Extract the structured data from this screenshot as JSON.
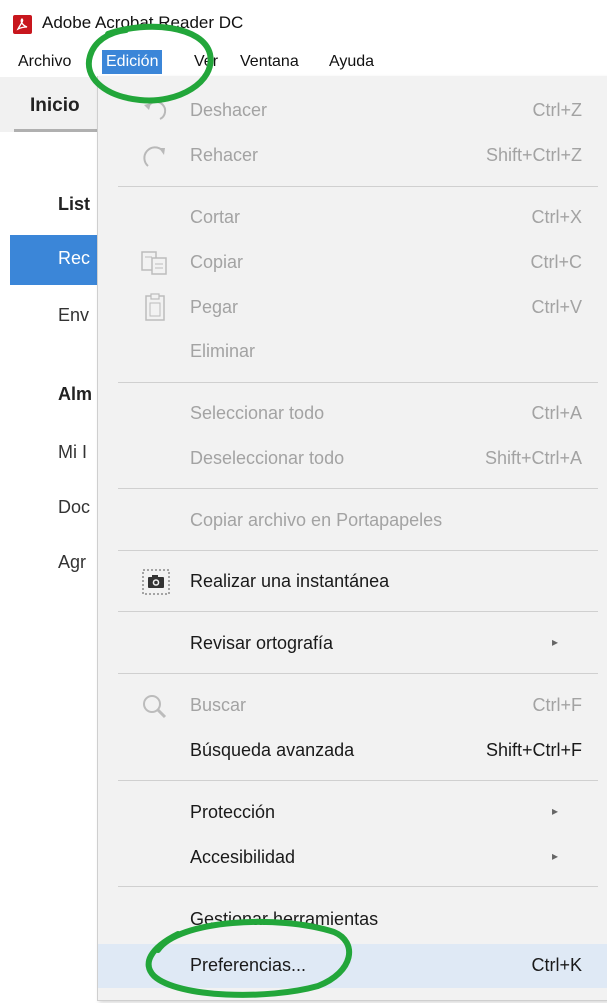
{
  "window": {
    "title": "Adobe Acrobat Reader DC"
  },
  "menubar": [
    {
      "label": "Archivo",
      "active": false
    },
    {
      "label": "Edición",
      "active": true
    },
    {
      "label": "Ver",
      "active": false
    },
    {
      "label": "Ventana",
      "active": false
    },
    {
      "label": "Ayuda",
      "active": false
    }
  ],
  "left_panel": {
    "tab": "Inicio",
    "items": [
      "List",
      "Rec",
      "Env",
      "Alm",
      "Mi I",
      "Doc",
      "Agr"
    ]
  },
  "edit_menu": {
    "items": [
      {
        "label": "Deshacer",
        "shortcut": "Ctrl+Z",
        "enabled": false,
        "icon": "undo-icon"
      },
      {
        "label": "Rehacer",
        "shortcut": "Shift+Ctrl+Z",
        "enabled": false,
        "icon": "redo-icon"
      },
      {
        "label": "Cortar",
        "shortcut": "Ctrl+X",
        "enabled": false
      },
      {
        "label": "Copiar",
        "shortcut": "Ctrl+C",
        "enabled": false,
        "icon": "copy-icon"
      },
      {
        "label": "Pegar",
        "shortcut": "Ctrl+V",
        "enabled": false,
        "icon": "paste-icon"
      },
      {
        "label": "Eliminar",
        "shortcut": "",
        "enabled": false
      },
      {
        "label": "Seleccionar todo",
        "shortcut": "Ctrl+A",
        "enabled": false
      },
      {
        "label": "Deseleccionar todo",
        "shortcut": "Shift+Ctrl+A",
        "enabled": false
      },
      {
        "label": "Copiar archivo en Portapapeles",
        "shortcut": "",
        "enabled": false
      },
      {
        "label": "Realizar una instantánea",
        "shortcut": "",
        "enabled": true,
        "icon": "camera-icon"
      },
      {
        "label": "Revisar ortografía",
        "shortcut": "",
        "enabled": true,
        "submenu": true
      },
      {
        "label": "Buscar",
        "shortcut": "Ctrl+F",
        "enabled": false,
        "icon": "search-icon"
      },
      {
        "label": "Búsqueda avanzada",
        "shortcut": "Shift+Ctrl+F",
        "enabled": true
      },
      {
        "label": "Protección",
        "shortcut": "",
        "enabled": true,
        "submenu": true
      },
      {
        "label": "Accesibilidad",
        "shortcut": "",
        "enabled": true,
        "submenu": true
      },
      {
        "label": "Gestionar herramientas",
        "shortcut": "",
        "enabled": true
      },
      {
        "label": "Preferencias...",
        "shortcut": "Ctrl+K",
        "enabled": true,
        "highlighted": true
      }
    ],
    "submenu_arrow": "▸"
  },
  "colors": {
    "menu_active": "#3b86d8",
    "hover": "#dfe9f5",
    "disabled_text": "#a3a3a3",
    "annotation": "#22a63a",
    "app_icon": "#c8161d"
  }
}
